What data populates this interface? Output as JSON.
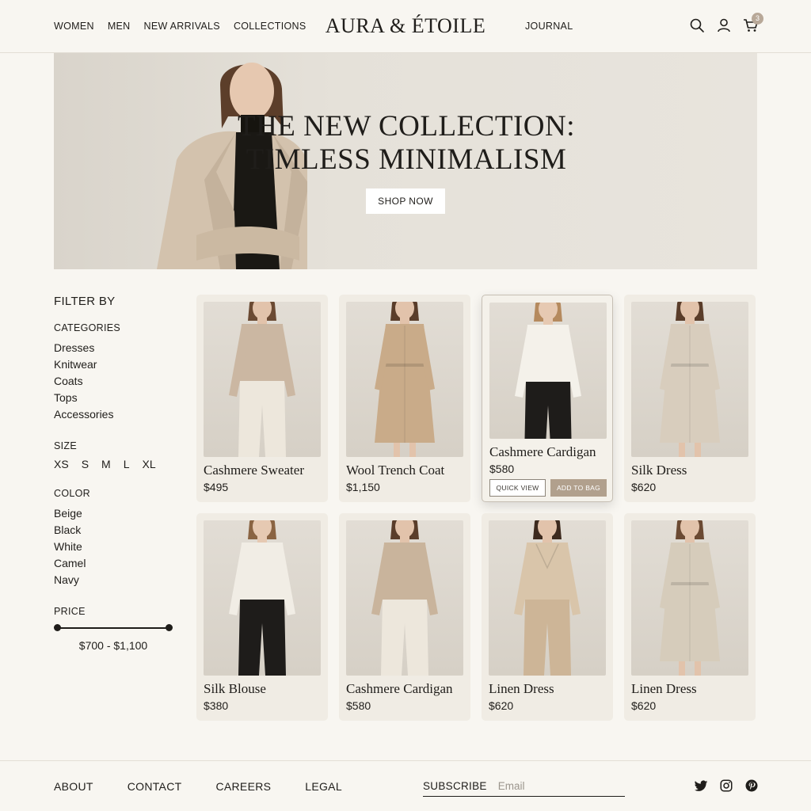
{
  "header": {
    "nav": [
      "WOMEN",
      "MEN",
      "NEW ARRIVALS",
      "COLLECTIONS"
    ],
    "logo": "AURA & ÉTOILE",
    "journal": "JOURNAL",
    "icons": [
      "search-icon",
      "user-icon",
      "cart-icon"
    ],
    "cart_count": "3"
  },
  "hero": {
    "title_line1": "THE NEW COLLECTION:",
    "title_line2": "TIMLESS MINIMALISM",
    "cta": "SHOP NOW"
  },
  "filters": {
    "title": "FILTER BY",
    "categories": {
      "label": "CATEGORIES",
      "items": [
        "Dresses",
        "Knitwear",
        "Coats",
        "Tops",
        "Accessories"
      ]
    },
    "size": {
      "label": "SIZE",
      "items": [
        "XS",
        "S",
        "M",
        "L",
        "XL"
      ]
    },
    "color": {
      "label": "COLOR",
      "items": [
        "Beige",
        "Black",
        "White",
        "Camel",
        "Navy"
      ]
    },
    "price": {
      "label": "PRICE",
      "range": "$700 - $1,100"
    }
  },
  "products": [
    {
      "name": "Cashmere Sweater",
      "price": "$495",
      "top": "#cbb7a2",
      "bottom": "#ede7dc",
      "skin": "#e2c3ab",
      "hair": "#6b4a33",
      "style": "sweater"
    },
    {
      "name": "Wool Trench Coat",
      "price": "$1,150",
      "top": "#c9ab89",
      "bottom": "#c9ab89",
      "skin": "#e2c3ab",
      "hair": "#5a3d2a",
      "style": "coat"
    },
    {
      "name": "Cashmere Cardigan",
      "price": "$580",
      "top": "#f4f1ea",
      "bottom": "#1e1c1a",
      "skin": "#e6c9b2",
      "hair": "#b58a5e",
      "style": "blouse"
    },
    {
      "name": "Silk Dress",
      "price": "$620",
      "top": "#d8cdbd",
      "bottom": "#d8cdbd",
      "skin": "#e2c3ab",
      "hair": "#5a3d2a",
      "style": "dress"
    },
    {
      "name": "Silk Blouse",
      "price": "$380",
      "top": "#f1ede5",
      "bottom": "#1e1c1a",
      "skin": "#e6c9b2",
      "hair": "#8a6443",
      "style": "blouse"
    },
    {
      "name": "Cashmere Cardigan",
      "price": "$580",
      "top": "#c9b49c",
      "bottom": "#ede7dc",
      "skin": "#e2c3ab",
      "hair": "#5a3d2a",
      "style": "sweater"
    },
    {
      "name": "Linen Dress",
      "price": "$620",
      "top": "#d9c5aa",
      "bottom": "#cdb597",
      "skin": "#e2c3ab",
      "hair": "#3d2a1e",
      "style": "wrap"
    },
    {
      "name": "Linen Dress",
      "price": "$620",
      "top": "#d6ccbb",
      "bottom": "#d6ccbb",
      "skin": "#e2c3ab",
      "hair": "#6b4a33",
      "style": "dress"
    }
  ],
  "active_card": {
    "quick_view": "QUICK VIEW",
    "add_to_bag": "ADD TO BAG"
  },
  "footer": {
    "links": [
      "ABOUT",
      "CONTACT",
      "CAREERS",
      "LEGAL"
    ],
    "subscribe_label": "SUBSCRIBE",
    "email_placeholder": "Email",
    "social": [
      "twitter-icon",
      "instagram-icon",
      "pinterest-icon"
    ]
  },
  "colors": {
    "background": "#f8f6f1",
    "card": "#f0ece4",
    "accent": "#b1a08d",
    "text": "#1f1d1a"
  }
}
